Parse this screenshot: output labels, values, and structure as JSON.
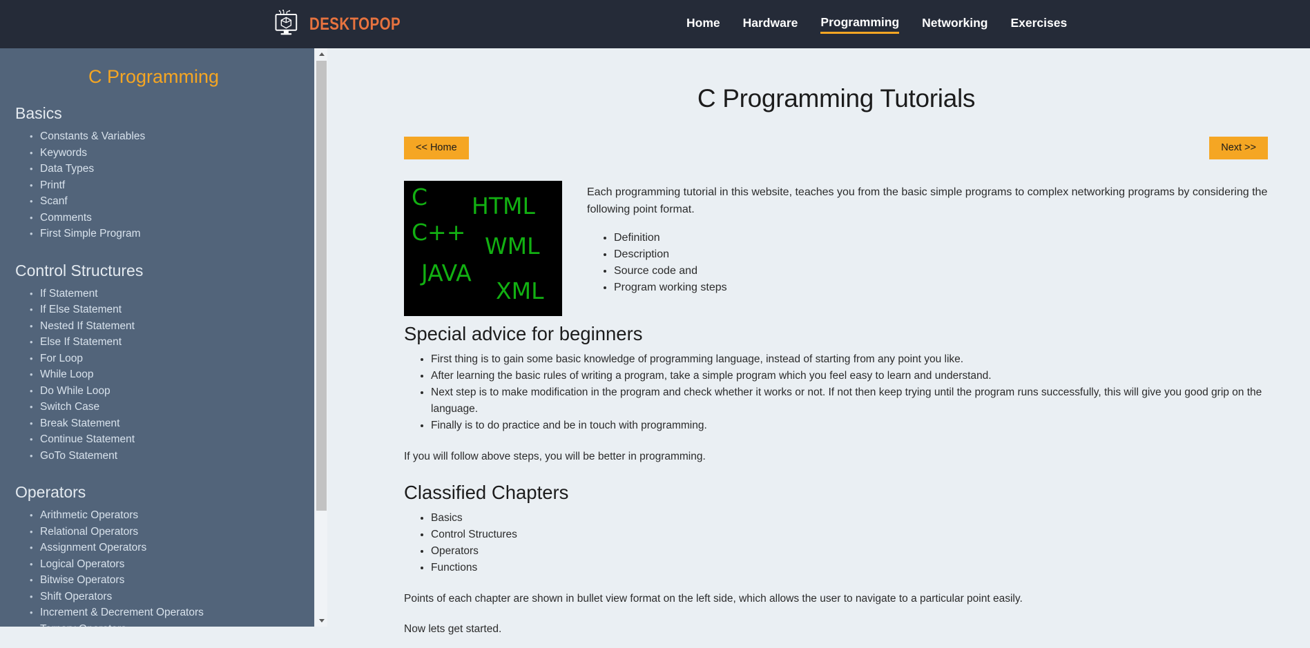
{
  "header": {
    "brand_name": "DESKTOPOP",
    "logo_icon": "desktop-cube-icon",
    "nav": [
      {
        "label": "Home",
        "active": false
      },
      {
        "label": "Hardware",
        "active": false
      },
      {
        "label": "Programming",
        "active": true
      },
      {
        "label": "Networking",
        "active": false
      },
      {
        "label": "Exercises",
        "active": false
      }
    ]
  },
  "sidebar": {
    "title": "C Programming",
    "sections": [
      {
        "heading": "Basics",
        "items": [
          "Constants & Variables",
          "Keywords",
          "Data Types",
          "Printf",
          "Scanf",
          "Comments",
          "First Simple Program"
        ]
      },
      {
        "heading": "Control Structures",
        "items": [
          "If Statement",
          "If Else Statement",
          "Nested If Statement",
          "Else If Statement",
          "For Loop",
          "While Loop",
          "Do While Loop",
          "Switch Case",
          "Break Statement",
          "Continue Statement",
          "GoTo Statement"
        ]
      },
      {
        "heading": "Operators",
        "items": [
          "Arithmetic Operators",
          "Relational Operators",
          "Assignment Operators",
          "Logical Operators",
          "Bitwise Operators",
          "Shift Operators",
          "Increment & Decrement Operators",
          "Ternary Operators"
        ]
      }
    ]
  },
  "main": {
    "page_title": "C Programming Tutorials",
    "prev_button": "<< Home",
    "next_button": "Next >>",
    "language_image": {
      "background_color": "#000000",
      "text_color": "#12b012",
      "labels": [
        "C",
        "HTML",
        "C++",
        "WML",
        "JAVA",
        "XML"
      ]
    },
    "intro_paragraph": "Each programming tutorial in this website, teaches you from the basic simple programs to complex networking programs by considering the following point format.",
    "format_points": [
      "Definition",
      "Description",
      "Source code and",
      "Program working steps"
    ],
    "advice_heading": "Special advice for beginners",
    "advice_points": [
      "First thing is to gain some basic knowledge of programming language, instead of starting from any point you like.",
      "After learning the basic rules of writing a program, take a simple program which you feel easy to learn and understand.",
      "Next step is to make modification in the program and check whether it works or not. If not then keep trying until the program runs successfully, this will give you good grip on the language.",
      "Finally is to do practice and be in touch with programming."
    ],
    "follow_steps_paragraph": "If you will follow above steps, you will be better in programming.",
    "chapters_heading": "Classified Chapters",
    "chapters": [
      "Basics",
      "Control Structures",
      "Operators",
      "Functions"
    ],
    "bullet_view_paragraph": "Points of each chapter are shown in bullet view format on the left side, which allows the user to navigate to a particular point easily.",
    "get_started_paragraph": "Now lets get started."
  },
  "colors": {
    "header_bg": "#252b38",
    "sidebar_bg": "#52647a",
    "content_bg": "#eaeff3",
    "accent_orange": "#f5a623",
    "brand_orange": "#e8733f"
  }
}
